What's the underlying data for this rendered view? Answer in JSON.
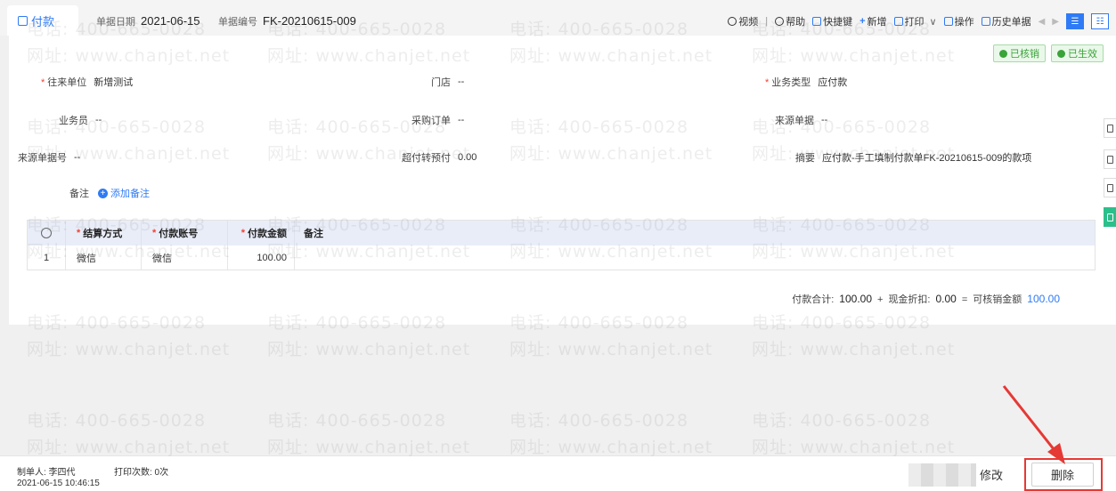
{
  "header": {
    "tab_label": "付款",
    "doc_date_label": "单据日期",
    "doc_date_value": "2021-06-15",
    "doc_no_label": "单据编号",
    "doc_no_value": "FK-20210615-009"
  },
  "toolbar": {
    "video": "视频",
    "help": "帮助",
    "shortcut": "快捷键",
    "new": "新增",
    "print": "打印",
    "operations": "操作",
    "history": "历史单据"
  },
  "badges": {
    "verified": "已核销",
    "effective": "已生效"
  },
  "form": {
    "partner_label": "往来单位",
    "partner_value": "新增测试",
    "store_label": "门店",
    "store_value": "--",
    "biz_type_label": "业务类型",
    "biz_type_value": "应付款",
    "salesman_label": "业务员",
    "salesman_value": "--",
    "po_label": "采购订单",
    "po_value": "--",
    "source_doc_label": "来源单据",
    "source_doc_value": "--",
    "source_no_label": "来源单据号",
    "source_no_value": "--",
    "overpay_label": "超付转预付",
    "overpay_value": "0.00",
    "summary_label": "摘要",
    "summary_value": "应付款-手工填制付款单FK-20210615-009的款项",
    "note_label": "备注",
    "add_note": "添加备注"
  },
  "table": {
    "headers": [
      "结算方式",
      "付款账号",
      "付款金额",
      "备注"
    ],
    "rows": [
      {
        "index": "1",
        "method": "微信",
        "account": "微信",
        "amount": "100.00",
        "note": ""
      }
    ]
  },
  "totals": {
    "pay_total_label": "付款合计:",
    "pay_total": "100.00",
    "plus": "+",
    "discount_label": "现金折扣:",
    "discount": "0.00",
    "equals": "=",
    "writeoff_label": "可核销金额",
    "writeoff": "100.00"
  },
  "footer": {
    "creator": "制单人: 李四代",
    "print_count": "打印次数: 0次",
    "created_at": "2021-06-15 10:46:15",
    "modify_label": "修改",
    "delete_label": "删除"
  },
  "watermark": {
    "phone": "电话: 400-665-0028",
    "site": "网址: www.chanjet.net"
  },
  "colors": {
    "accent": "#2f7bf5",
    "success": "#3aa33a",
    "annotation": "#e53935"
  }
}
